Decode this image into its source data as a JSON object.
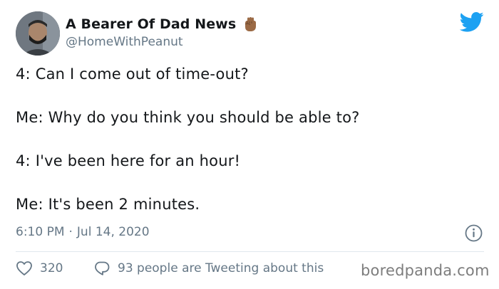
{
  "author": {
    "display_name": "A Bearer Of Dad News",
    "handle": "@HomeWithPeanut",
    "badge_icon": "raised-fist-emoji-icon"
  },
  "platform_icon": "twitter-bird-icon",
  "tweet": {
    "lines": [
      "4: Can I come out of time-out?",
      "Me: Why do you think you should be able to?",
      "4: I've been here for an hour!",
      "Me: It's been 2 minutes."
    ],
    "time": "6:10 PM",
    "separator": "·",
    "date": "Jul 14, 2020"
  },
  "actions": {
    "likes_count": "320",
    "discussion_text": "93 people are Tweeting about this"
  },
  "watermark": "boredpanda.com",
  "colors": {
    "twitter_blue": "#1da1f2",
    "muted_text": "#657786",
    "fist_skin": "#9b6a45"
  }
}
